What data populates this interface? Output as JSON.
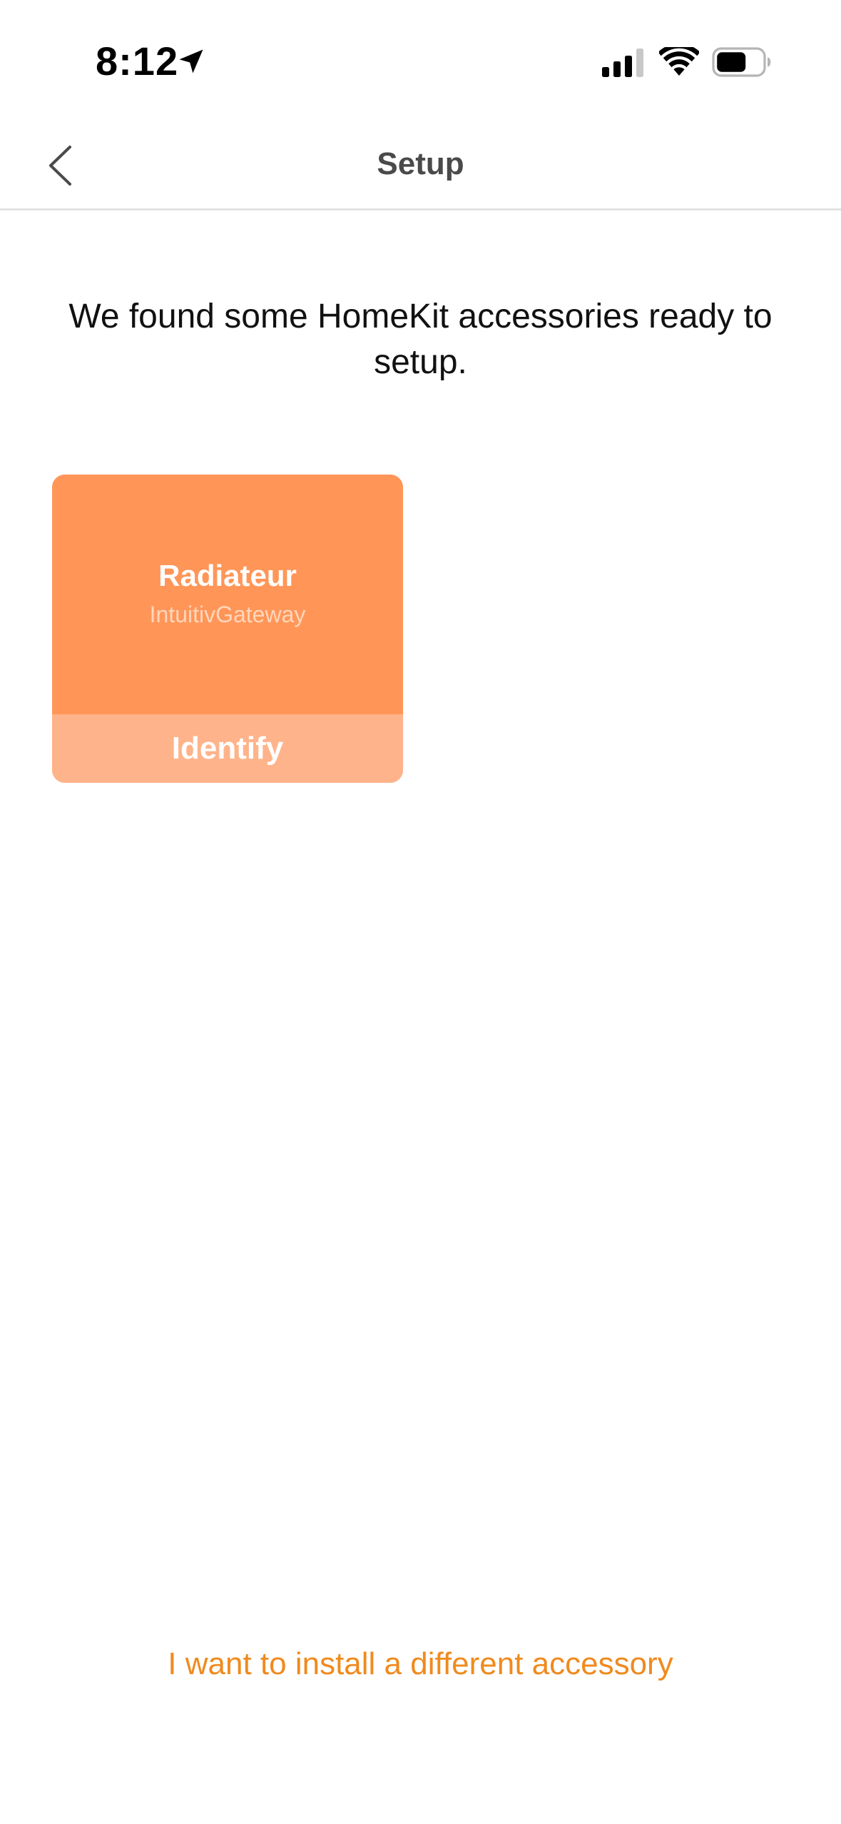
{
  "status_bar": {
    "time": "8:12",
    "icons": [
      "location-arrow-icon",
      "cellular-signal-icon",
      "wifi-icon",
      "battery-icon"
    ]
  },
  "nav": {
    "title": "Setup",
    "back_icon": "chevron-left-icon"
  },
  "headline": "We found some HomeKit accessories ready to setup.",
  "accessories": [
    {
      "name": "Radiateur",
      "model": "IntuitivGateway",
      "identify_label": "Identify"
    }
  ],
  "footer": {
    "link_label": "I want to install a different accessory"
  },
  "colors": {
    "card_background": "#ff9658",
    "identify_background": "#ffb38a",
    "link_color": "#f08a1e",
    "nav_title_color": "#4a4a4a"
  }
}
